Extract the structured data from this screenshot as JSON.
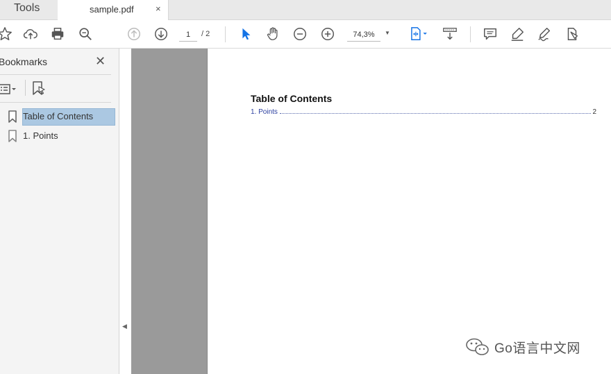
{
  "tabs": {
    "tools_label": "Tools",
    "document_label": "sample.pdf",
    "close_label": "×"
  },
  "toolbar": {
    "icons": [
      "star-icon",
      "cloud-upload-icon",
      "print-icon",
      "zoom-search-icon",
      "page-up-icon",
      "page-down-icon",
      "select-arrow-icon",
      "hand-icon",
      "zoom-out-icon",
      "zoom-in-icon",
      "fit-page-icon",
      "scroll-mode-icon",
      "comment-icon",
      "highlight-icon",
      "sign-icon",
      "more-tools-icon"
    ],
    "page_current": "1",
    "page_total": "/ 2",
    "zoom": "74,3%",
    "accent_color": "#1473e6"
  },
  "sidebar": {
    "title": "Bookmarks",
    "close_label": "✕",
    "bookmarks": [
      {
        "label": "Table of Contents",
        "selected": true
      },
      {
        "label": "1. Points",
        "selected": false
      }
    ]
  },
  "document": {
    "toc_title": "Table of Contents",
    "toc_entries": [
      {
        "label": "1. Points",
        "page": "2"
      }
    ]
  },
  "watermark": {
    "text": "Go语言中文网"
  }
}
